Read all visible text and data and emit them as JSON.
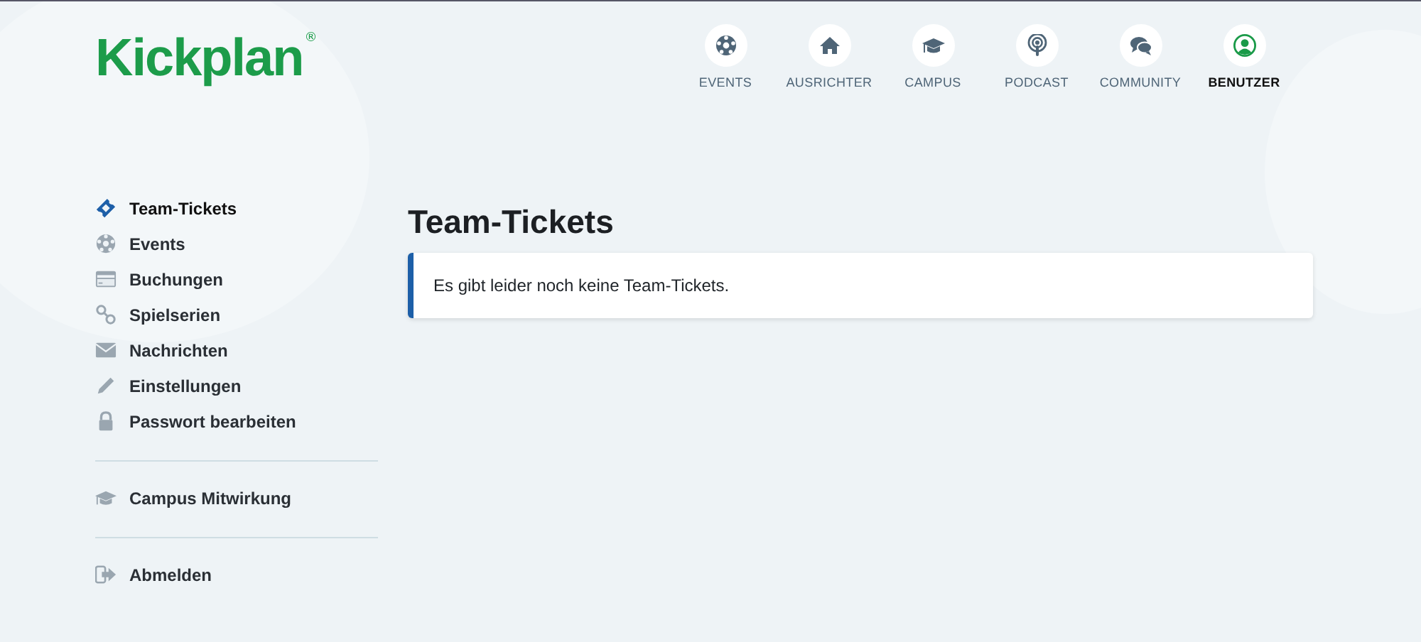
{
  "logo": {
    "text": "Kickplan",
    "mark": "®"
  },
  "nav": [
    {
      "label": "EVENTS",
      "kind": "ball",
      "selected": false
    },
    {
      "label": "AUSRICHTER",
      "kind": "home",
      "selected": false
    },
    {
      "label": "CAMPUS",
      "kind": "cap",
      "selected": false
    },
    {
      "label": "PODCAST",
      "kind": "podcast",
      "selected": false
    },
    {
      "label": "COMMUNITY",
      "kind": "chat",
      "selected": false
    },
    {
      "label": "BENUTZER",
      "kind": "user",
      "selected": true
    }
  ],
  "sidebar": {
    "groups": [
      [
        {
          "label": "Team-Tickets",
          "kind": "ticket",
          "selected": true
        },
        {
          "label": "Events",
          "kind": "ball",
          "selected": false
        },
        {
          "label": "Buchungen",
          "kind": "card",
          "selected": false
        },
        {
          "label": "Spielserien",
          "kind": "link",
          "selected": false
        },
        {
          "label": "Nachrichten",
          "kind": "mail",
          "selected": false
        },
        {
          "label": "Einstellungen",
          "kind": "pencil",
          "selected": false
        },
        {
          "label": "Passwort bearbeiten",
          "kind": "lock",
          "selected": false
        }
      ],
      [
        {
          "label": "Campus Mitwirkung",
          "kind": "cap",
          "selected": false
        }
      ],
      [
        {
          "label": "Abmelden",
          "kind": "logout",
          "selected": false
        }
      ]
    ]
  },
  "main": {
    "title": "Team-Tickets",
    "notice": "Es gibt leider noch keine Team-Tickets."
  }
}
